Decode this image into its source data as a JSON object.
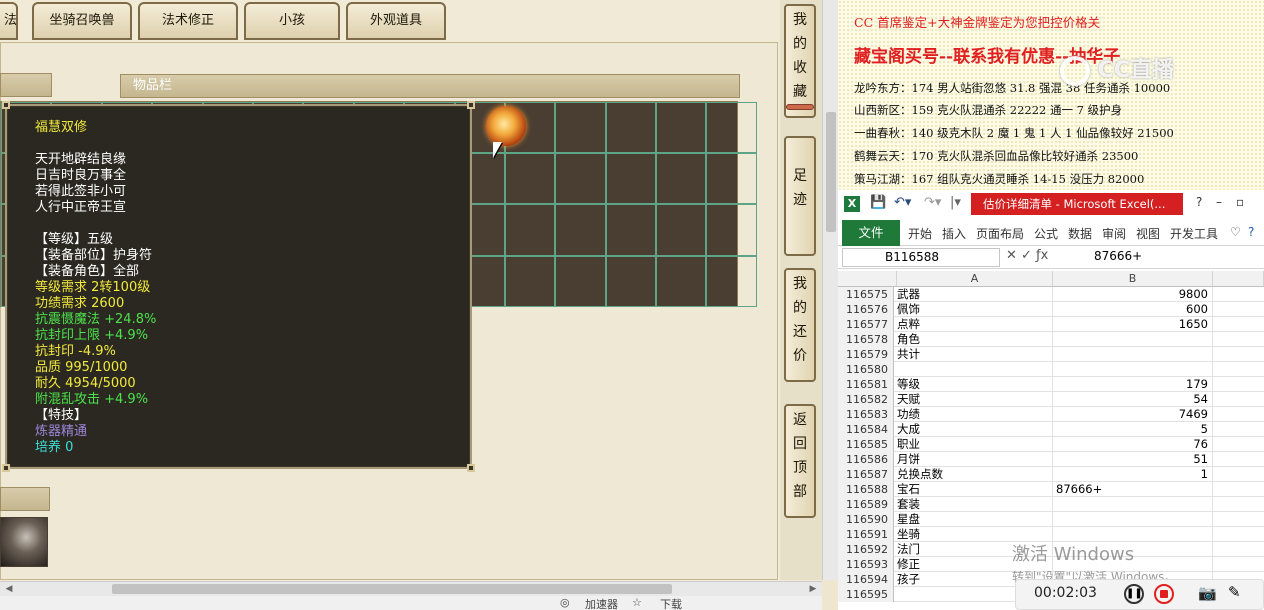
{
  "game": {
    "tabs": [
      "法",
      "坐骑召唤兽",
      "法术修正",
      "小孩",
      "外观道具"
    ],
    "inventory_header": "物品栏",
    "tooltip": {
      "title": "福慧双修",
      "poem": [
        "天开地辟结良缘",
        "日吉时良万事全",
        "若得此签非小可",
        "人行中正帝王宣"
      ],
      "attrs_white": [
        "【等级】五级",
        "【装备部位】护身符",
        "【装备角色】全部"
      ],
      "reqs_yellow": [
        "等级需求 2转100级",
        "功绩需求 2600"
      ],
      "bonus_green": [
        "抗震慑魔法 +24.8%",
        "抗封印上限 +4.9%"
      ],
      "penalty": "抗封印 -4.9%",
      "quality": "品质 995/1000",
      "durability": "耐久 4954/5000",
      "extra_green": "附混乱攻击 +4.9%",
      "special_header": "【特技】",
      "special": "炼器精通",
      "cultivate": "培养 0"
    },
    "side_menu": [
      "我的收藏",
      "足迹",
      "我的还价",
      "返回顶部"
    ],
    "status": [
      "加速器",
      "下载"
    ]
  },
  "doc": {
    "line_top": "CC 首席鉴定+大神金牌鉴定为您把控价格关",
    "headline": "藏宝阁买号--联系我有优惠--抽华子",
    "watermark": "CC直播",
    "entries": [
      "龙吟东方：174 男人站街忽悠 31.8 强混 38 任务通杀 10000",
      "山西新区：159 克火队混通杀 22222 通一 7 级护身",
      "一曲春秋：140 级克木队 2 魔 1 鬼 1 人 1 仙品像较好 21500",
      "鹤舞云天：170 克火队混杀回血品像比较好通杀 23500",
      "策马江湖：167 组队克火通灵睡杀 14-15 没压力 82000"
    ]
  },
  "excel": {
    "title": "估价详细清单 - Microsoft Excel(...",
    "ribbon_tabs": [
      "开始",
      "插入",
      "页面布局",
      "公式",
      "数据",
      "审阅",
      "视图",
      "开发工具"
    ],
    "file_tab": "文件",
    "name_box": "B116588",
    "formula_value": "87666+",
    "col_a": "A",
    "col_b": "B",
    "rows": [
      {
        "n": "116575",
        "a": "武器",
        "b": "9800"
      },
      {
        "n": "116576",
        "a": "佩饰",
        "b": "600"
      },
      {
        "n": "116577",
        "a": "点粹",
        "b": "1650"
      },
      {
        "n": "116578",
        "a": "角色",
        "b": ""
      },
      {
        "n": "116579",
        "a": "共计",
        "b": ""
      },
      {
        "n": "116580",
        "a": "",
        "b": ""
      },
      {
        "n": "116581",
        "a": "等级",
        "b": "179"
      },
      {
        "n": "116582",
        "a": "天赋",
        "b": "54"
      },
      {
        "n": "116583",
        "a": "功绩",
        "b": "7469"
      },
      {
        "n": "116584",
        "a": "大成",
        "b": "5"
      },
      {
        "n": "116585",
        "a": "职业",
        "b": "76"
      },
      {
        "n": "116586",
        "a": "月饼",
        "b": "51"
      },
      {
        "n": "116587",
        "a": "兑换点数",
        "b": "1"
      },
      {
        "n": "116588",
        "a": "宝石",
        "b": "87666+"
      },
      {
        "n": "116589",
        "a": "套装",
        "b": ""
      },
      {
        "n": "116590",
        "a": "星盘",
        "b": ""
      },
      {
        "n": "116591",
        "a": "坐骑",
        "b": ""
      },
      {
        "n": "116592",
        "a": "法门",
        "b": ""
      },
      {
        "n": "116593",
        "a": "修正",
        "b": ""
      },
      {
        "n": "116594",
        "a": "孩子",
        "b": ""
      },
      {
        "n": "116595",
        "a": "",
        "b": ""
      }
    ]
  },
  "overlay": {
    "activate": "激活 Windows",
    "activate_sub": "转到\"设置\"以激活 Windows。",
    "timer": "00:02:03"
  }
}
